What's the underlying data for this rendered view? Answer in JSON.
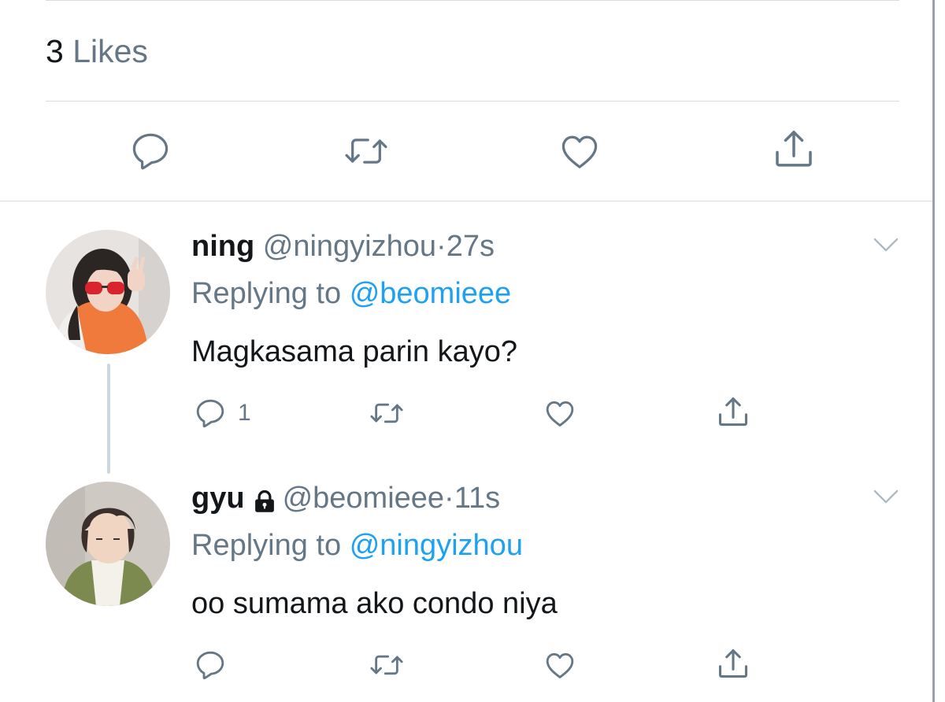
{
  "likes": {
    "count": "3",
    "label": "Likes"
  },
  "tweets": [
    {
      "name": "ning",
      "handle": "@ningyizhou",
      "sep": "·",
      "time": "27s",
      "reply_prefix": "Replying to",
      "reply_to": "@beomieee",
      "text": "Magkasama parin kayo?",
      "reply_count": "1",
      "locked": false
    },
    {
      "name": "gyu",
      "handle": "@beomieee",
      "sep": "·",
      "time": "11s",
      "reply_prefix": "Replying to",
      "reply_to": "@ningyizhou",
      "text": "oo sumama ako condo niya",
      "reply_count": "",
      "locked": true
    }
  ],
  "icons": {
    "reply": "reply-icon",
    "retweet": "retweet-icon",
    "like": "heart-icon",
    "share": "share-icon",
    "more": "chevron-down-icon",
    "lock": "lock-icon"
  },
  "colors": {
    "link": "#1da1f2",
    "muted": "#657786",
    "icon": "#657786",
    "text": "#14171a"
  }
}
